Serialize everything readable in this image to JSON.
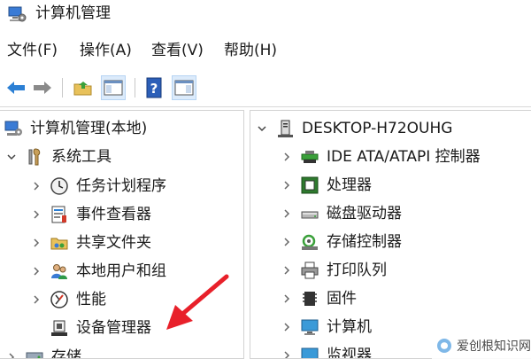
{
  "window": {
    "title": "计算机管理",
    "app_icon": "computer-management-icon"
  },
  "menu": [
    {
      "label": "文件(F)"
    },
    {
      "label": "操作(A)"
    },
    {
      "label": "查看(V)"
    },
    {
      "label": "帮助(H)"
    }
  ],
  "toolbar": {
    "buttons": [
      {
        "icon": "back-arrow-icon"
      },
      {
        "icon": "forward-arrow-icon"
      },
      {
        "icon": "up-folder-icon"
      },
      {
        "icon": "show-hide-console-tree-icon"
      },
      {
        "icon": "help-icon"
      },
      {
        "icon": "show-hide-action-pane-icon"
      }
    ]
  },
  "left_tree": {
    "root": {
      "label": "计算机管理(本地)",
      "icon": "computer-management-icon"
    },
    "system_tools": {
      "label": "系统工具",
      "icon": "tools-icon",
      "expanded": true
    },
    "items": [
      {
        "label": "任务计划程序",
        "icon": "clock-icon"
      },
      {
        "label": "事件查看器",
        "icon": "event-viewer-icon"
      },
      {
        "label": "共享文件夹",
        "icon": "shared-folder-icon"
      },
      {
        "label": "本地用户和组",
        "icon": "users-icon"
      },
      {
        "label": "性能",
        "icon": "performance-icon"
      },
      {
        "label": "设备管理器",
        "icon": "device-manager-icon"
      }
    ],
    "storage": {
      "label": "存储",
      "icon": "storage-icon"
    }
  },
  "right_tree": {
    "root": {
      "label": "DESKTOP-H72OUHG",
      "icon": "computer-tower-icon"
    },
    "items": [
      {
        "label": "IDE ATA/ATAPI 控制器",
        "icon": "ide-controller-icon"
      },
      {
        "label": "处理器",
        "icon": "processor-icon"
      },
      {
        "label": "磁盘驱动器",
        "icon": "disk-drive-icon"
      },
      {
        "label": "存储控制器",
        "icon": "storage-controller-icon"
      },
      {
        "label": "打印队列",
        "icon": "printer-icon"
      },
      {
        "label": "固件",
        "icon": "firmware-icon"
      },
      {
        "label": "计算机",
        "icon": "monitor-icon"
      },
      {
        "label": "监视器",
        "icon": "monitor-icon"
      }
    ]
  },
  "annotation": {
    "color": "#e8202a"
  },
  "watermark": {
    "text": "爱创根知识网"
  },
  "colors": {
    "accent": "#2b7fd4",
    "pressed_bg": "#dcebfb",
    "separator": "#d2d2d2"
  }
}
